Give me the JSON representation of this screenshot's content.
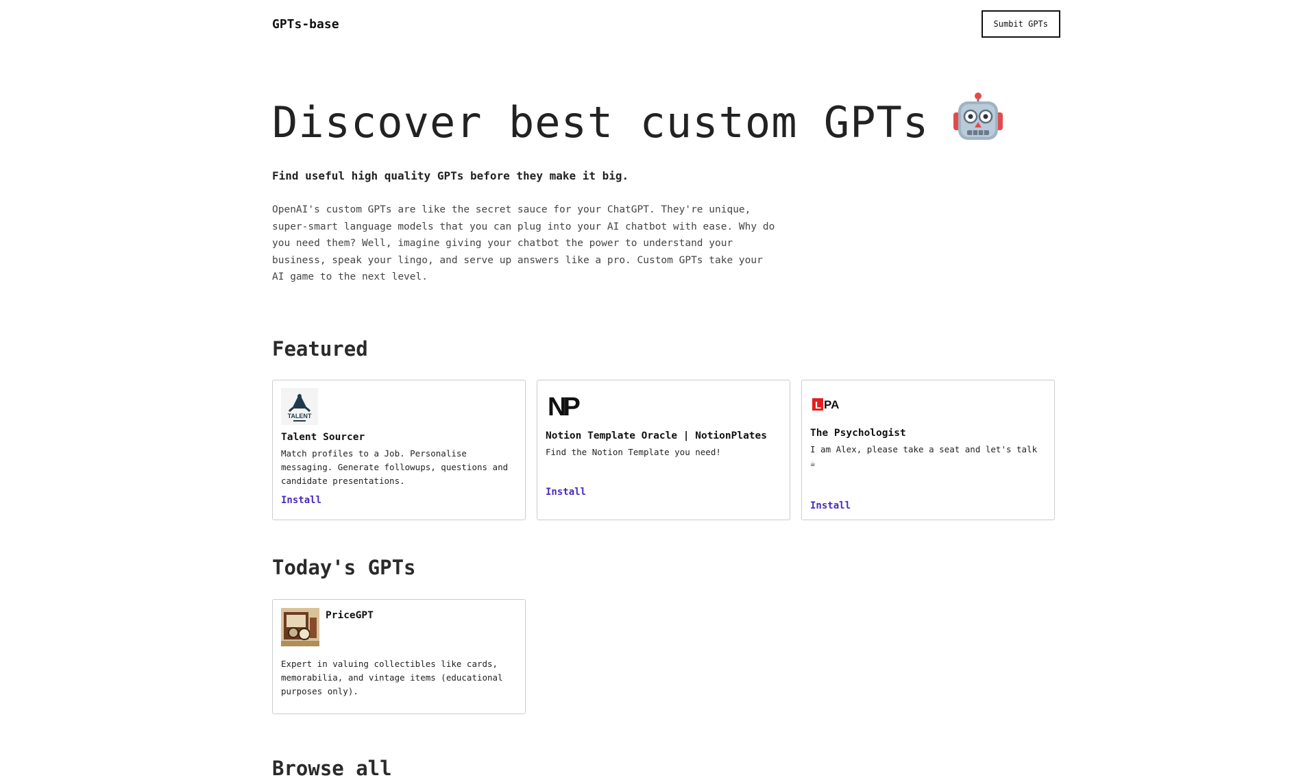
{
  "header": {
    "brand": "GPTs-base",
    "submit_label": "Sumbit GPTs"
  },
  "hero": {
    "title": "Discover best custom GPTs",
    "emoji_icon": "robot-icon",
    "subtitle": "Find useful high quality GPTs before they make it big.",
    "intro": "OpenAI's custom GPTs are like the secret sauce for your ChatGPT. They're unique, super-smart language models that you can plug into your AI chatbot with ease. Why do you need them? Well, imagine giving your chatbot the power to understand your business, speak your lingo, and serve up answers like a pro. Custom GPTs take your AI game to the next level."
  },
  "featured": {
    "title": "Featured",
    "items": [
      {
        "name": "Talent Sourcer",
        "description": "Match profiles to a Job. Personalise messaging. Generate followups, questions and candidate presentations.",
        "install_label": "Install",
        "logo_icon": "talent-sourcer-logo",
        "logo_text": "TALENT"
      },
      {
        "name": "Notion Template Oracle | NotionPlates",
        "description": "Find the Notion Template you need!",
        "install_label": "Install",
        "logo_icon": "notionplates-logo",
        "logo_text": "NP"
      },
      {
        "name": "The Psychologist",
        "description": "I am Alex, please take a seat and let's talk ☕",
        "install_label": "Install",
        "logo_icon": "lpa-logo",
        "logo_text": "PA"
      }
    ]
  },
  "today": {
    "title": "Today's GPTs",
    "items": [
      {
        "name": "PriceGPT",
        "description": "Expert in valuing collectibles like cards, memorabilia, and vintage items (educational purposes only).",
        "logo_icon": "pricegpt-logo"
      }
    ]
  },
  "browse": {
    "title": "Browse all"
  },
  "colors": {
    "accent_link": "#4a2bbf",
    "border": "#cccccc",
    "text": "#222222",
    "lpa_red": "#e02020"
  }
}
